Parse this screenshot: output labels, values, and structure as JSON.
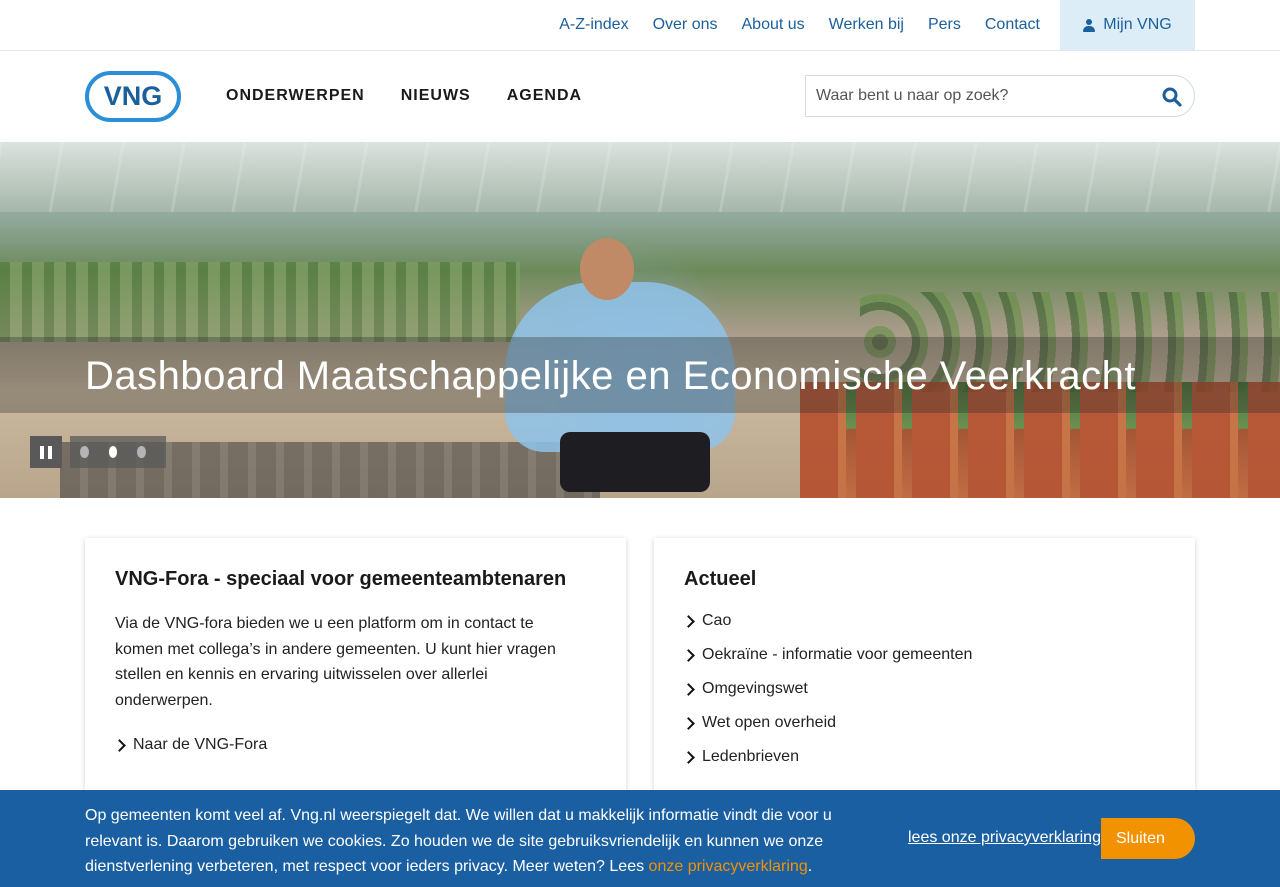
{
  "topbar": {
    "links": [
      "A-Z-index",
      "Over ons",
      "About us",
      "Werken bij",
      "Pers",
      "Contact"
    ],
    "account_label": "Mijn VNG",
    "account_icon": "user-icon"
  },
  "header": {
    "logo_text": "VNG",
    "nav": [
      "ONDERWERPEN",
      "NIEUWS",
      "AGENDA"
    ],
    "search_placeholder": "Waar bent u naar op zoek?",
    "search_icon": "search-icon"
  },
  "hero": {
    "title": "Dashboard Maatschappelijke en Economische Veerkracht",
    "slide_count": 3,
    "active_slide": 2
  },
  "cards": {
    "fora": {
      "title": "VNG-Fora - speciaal voor gemeenteambtenaren",
      "body": "Via de VNG-fora bieden we u een platform om in contact te komen met collega’s in andere gemeenten. U kunt hier vragen stellen en kennis en ervaring uitwisselen over allerlei onderwerpen.",
      "link": "Naar de VNG-Fora"
    },
    "actueel": {
      "title": "Actueel",
      "items": [
        "Cao",
        "Oekraïne - informatie voor gemeenten",
        "Omgevingswet",
        "Wet open overheid",
        "Ledenbrieven"
      ]
    }
  },
  "cookie": {
    "text": "Op gemeenten komt veel af. Vng.nl weerspiegelt dat. We willen dat u makkelijk informatie vindt die voor u relevant is. Daarom gebruiken we cookies. Zo houden we de site gebruiksvriendelijk en kunnen we onze dienstverlening verbeteren, met respect voor ieders privacy. Meer weten? Lees ",
    "inline_link": "onze privacyverklaring",
    "text_end": ".",
    "privacy_link": "lees onze privacyverklaring",
    "close_label": "Sluiten"
  },
  "colors": {
    "brand_blue": "#1b5f9c",
    "logo_blue": "#2a8fd6",
    "cookie_bg": "#1b5fa3",
    "accent_orange": "#f39200"
  }
}
